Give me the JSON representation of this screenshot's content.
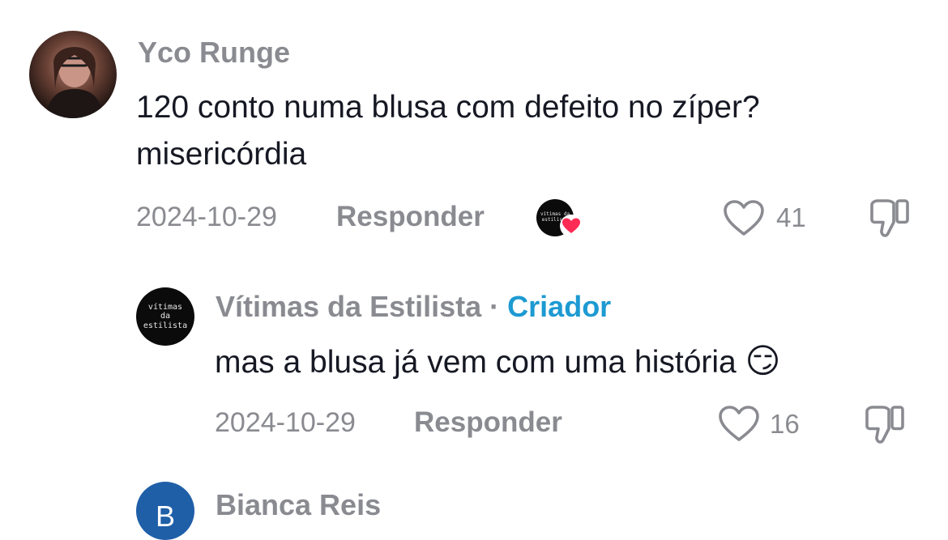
{
  "comments": [
    {
      "author": "Yco Runge",
      "text_line1": "120 conto numa blusa com defeito no zíper?",
      "text_line2": "misericórdia",
      "date": "2024-10-29",
      "reply_label": "Responder",
      "likes": "41",
      "liked_by_creator_avatar_text": "vítimas da estilista"
    },
    {
      "author": "Vítimas da Estilista",
      "separator": "·",
      "creator_tag": "Criador",
      "avatar_text": [
        "vítimas",
        "da",
        "estilista"
      ],
      "text": "mas a blusa já vem com uma história",
      "emoji": "😏",
      "date": "2024-10-29",
      "reply_label": "Responder",
      "likes": "16"
    },
    {
      "author": "Bianca Reis",
      "avatar_initial": "B"
    }
  ],
  "icons": {
    "like": "heart-outline-icon",
    "dislike": "thumbs-down-outline-icon",
    "creator_liked": "red-heart-badge-icon"
  },
  "colors": {
    "creator_tag": "#1d9ad2",
    "heart_badge": "#fe2c55",
    "muted_text": "#8a8b91"
  }
}
